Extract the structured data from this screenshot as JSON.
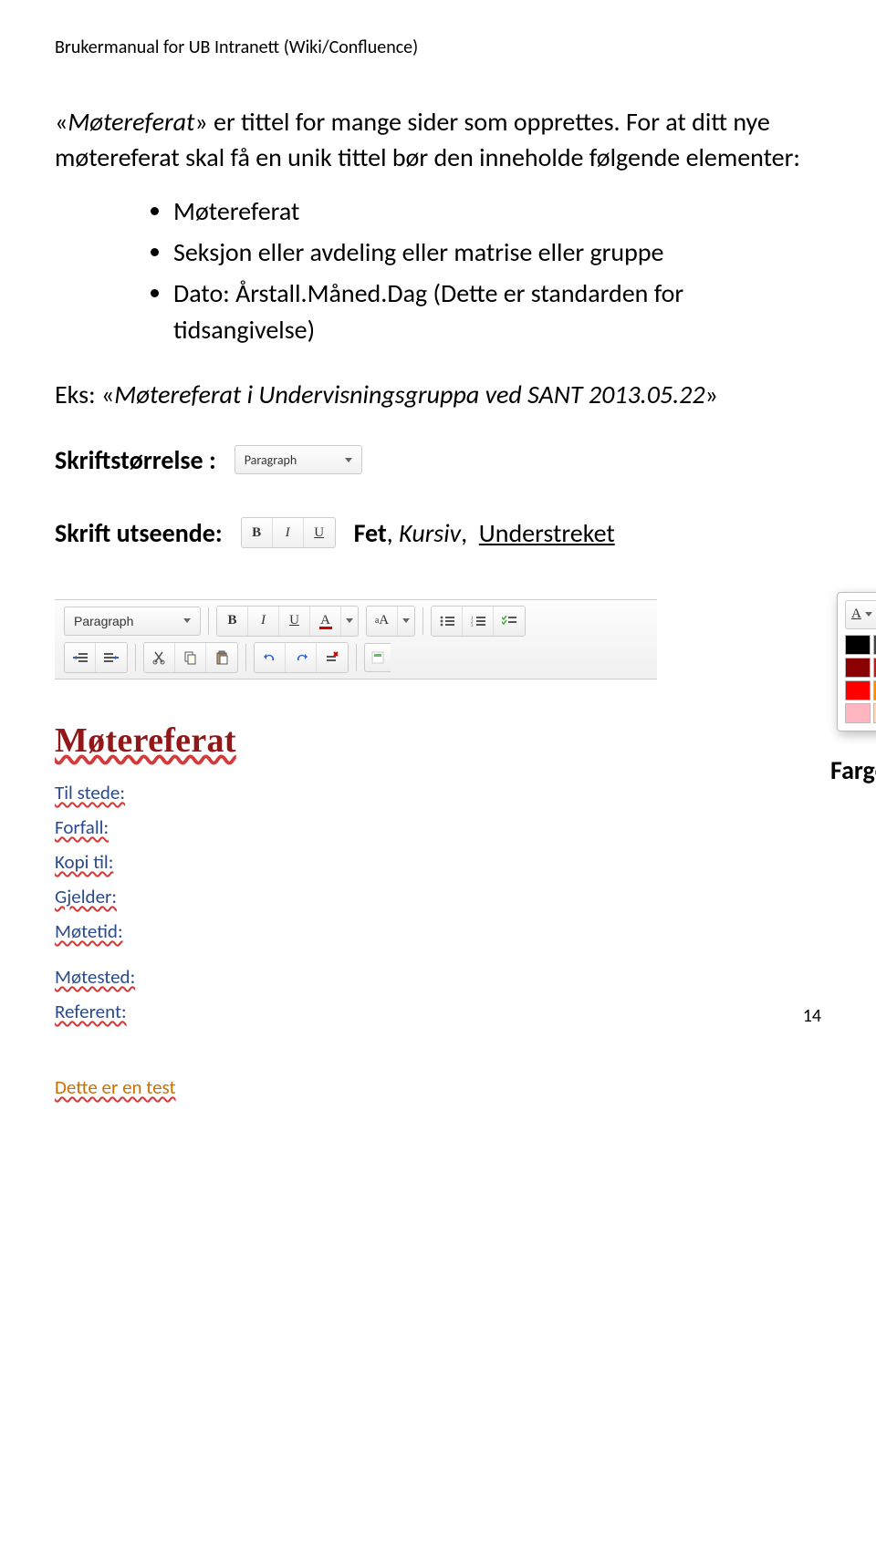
{
  "header": "Brukermanual for UB Intranett (Wiki/Confluence)",
  "p1_prefix": "«",
  "p1_italic": "Møtereferat",
  "p1_rest": "» er tittel for mange  sider som opprettes. For at ditt nye møtereferat skal få en unik tittel bør den inneholde følgende elementer:",
  "bullets": [
    "Møtereferat",
    "Seksjon eller avdeling eller matrise eller gruppe",
    "Dato: Årstall.Måned.Dag (Dette er standarden for tidsangivelse)"
  ],
  "example_prefix": "Eks: «",
  "example_italic": "Møtereferat i Undervisningsgruppa ved SANT 2013.05.22",
  "example_suffix": "»",
  "size_label": "Skriftstørrelse :",
  "paragraph_dd": "Paragraph",
  "style_label": "Skrift utseende:",
  "tail_bold": "Fet",
  "tail_sep": ", ",
  "tail_italic": "Kursiv",
  "tail_underline": "Understreket",
  "palette_caption": "Fargepallett for skrift",
  "editor_title": "Møtereferat",
  "fields": [
    "Til stede:",
    "Forfall:",
    "Kopi til:",
    "Gjelder:",
    "Møtetid:",
    "Møtested:",
    "Referent:"
  ],
  "page_number": "14",
  "test_line": "Dette er en test",
  "palette_colors": [
    "#000000",
    "#444444",
    "#666666",
    "#999999",
    "#cccccc",
    "#eeeeee",
    "#f4f4f4",
    "#ffffff",
    "#8b0000",
    "#b22222",
    "#cd5c1c",
    "#daa520",
    "#228b22",
    "#008b8b",
    "#00008b",
    "#4b0082",
    "#ff0000",
    "#ff8c00",
    "#ffd700",
    "#adff2f",
    "#00ff00",
    "#00ffff",
    "#0080ff",
    "#8a2be2",
    "#ffb6c1",
    "#ffdab9",
    "#ffffe0",
    "#f0fff0",
    "#e0ffff",
    "#d6e4ff",
    "#e0d6ff",
    "#ffffff"
  ]
}
